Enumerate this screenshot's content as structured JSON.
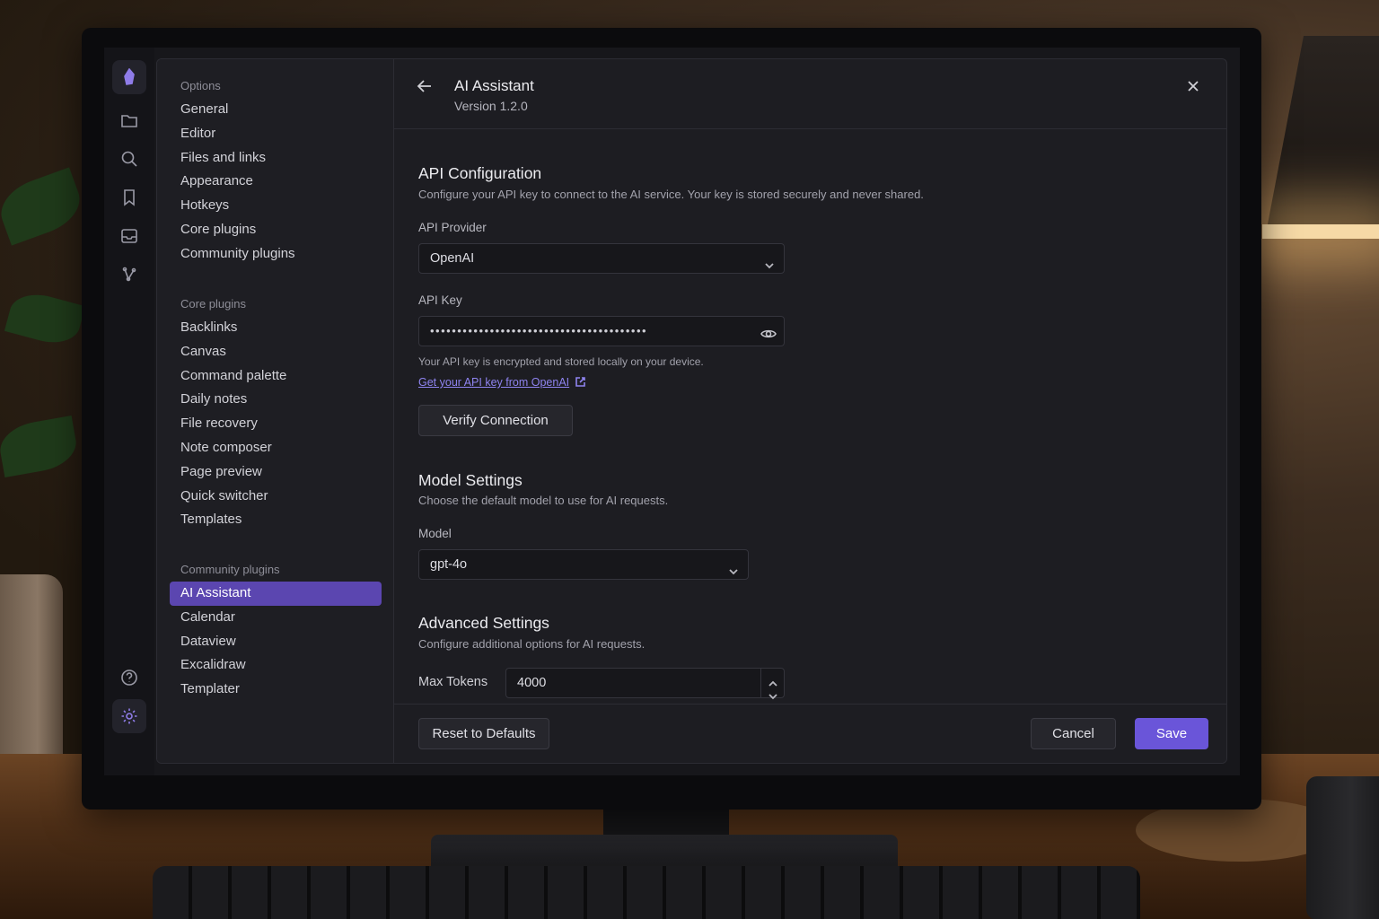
{
  "window": {
    "title": "AI Assistant",
    "version": "Version 1.2.0"
  },
  "nav": {
    "options_heading": "Options",
    "options": [
      "General",
      "Editor",
      "Files and links",
      "Appearance",
      "Hotkeys",
      "Core plugins",
      "Community plugins"
    ],
    "core_heading": "Core plugins",
    "core": [
      "Backlinks",
      "Canvas",
      "Command palette",
      "Daily notes",
      "File recovery",
      "Note composer",
      "Page preview",
      "Quick switcher",
      "Templates"
    ],
    "community_heading": "Community plugins",
    "community": [
      "AI Assistant",
      "Calendar",
      "Dataview",
      "Excalidraw",
      "Templater"
    ],
    "selected": "AI Assistant"
  },
  "api": {
    "title": "API Configuration",
    "description": "Configure your API key to connect to the AI service. Your key is stored securely and never shared.",
    "provider_label": "API Provider",
    "provider_value": "OpenAI",
    "key_label": "API Key",
    "key_value": "••••••••••••••••••••••••••••••••••••••••",
    "key_help": "Your API key is encrypted and stored locally on your device.",
    "key_link": "Get your API key from OpenAI",
    "verify_button": "Verify Connection"
  },
  "model": {
    "title": "Model Settings",
    "description": "Choose the default model to use for AI requests.",
    "label": "Model",
    "value": "gpt-4o"
  },
  "advanced": {
    "title": "Advanced Settings",
    "description": "Configure additional options for AI requests.",
    "max_tokens_label": "Max Tokens",
    "max_tokens_value": "4000"
  },
  "footer": {
    "reset": "Reset to Defaults",
    "cancel": "Cancel",
    "save": "Save"
  },
  "colors": {
    "accent": "#6a55d9",
    "selected_nav": "#5b46b0",
    "link": "#8f84f0"
  },
  "ribbon_icons": [
    "logo-icon",
    "folder-icon",
    "search-icon",
    "bookmark-icon",
    "inbox-icon",
    "graph-icon",
    "help-icon",
    "settings-icon"
  ]
}
